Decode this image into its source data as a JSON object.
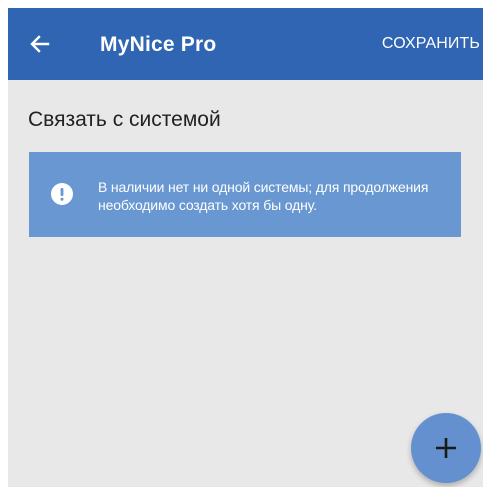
{
  "app_bar": {
    "title": "MyNice Pro",
    "save_label": "СОХРАНИТЬ",
    "back_icon": "arrow-left-icon",
    "background_color": "#2f65b2"
  },
  "page": {
    "section_title": "Связать с системой",
    "background_color": "#e8e8e9"
  },
  "info_banner": {
    "icon": "exclamation-circle-icon",
    "message": "В наличии нет ни одной системы; для продолжения необходимо создать хотя бы одну.",
    "background_color": "#6897d2"
  },
  "fab": {
    "icon": "plus-icon",
    "background_color": "#6490d0"
  }
}
